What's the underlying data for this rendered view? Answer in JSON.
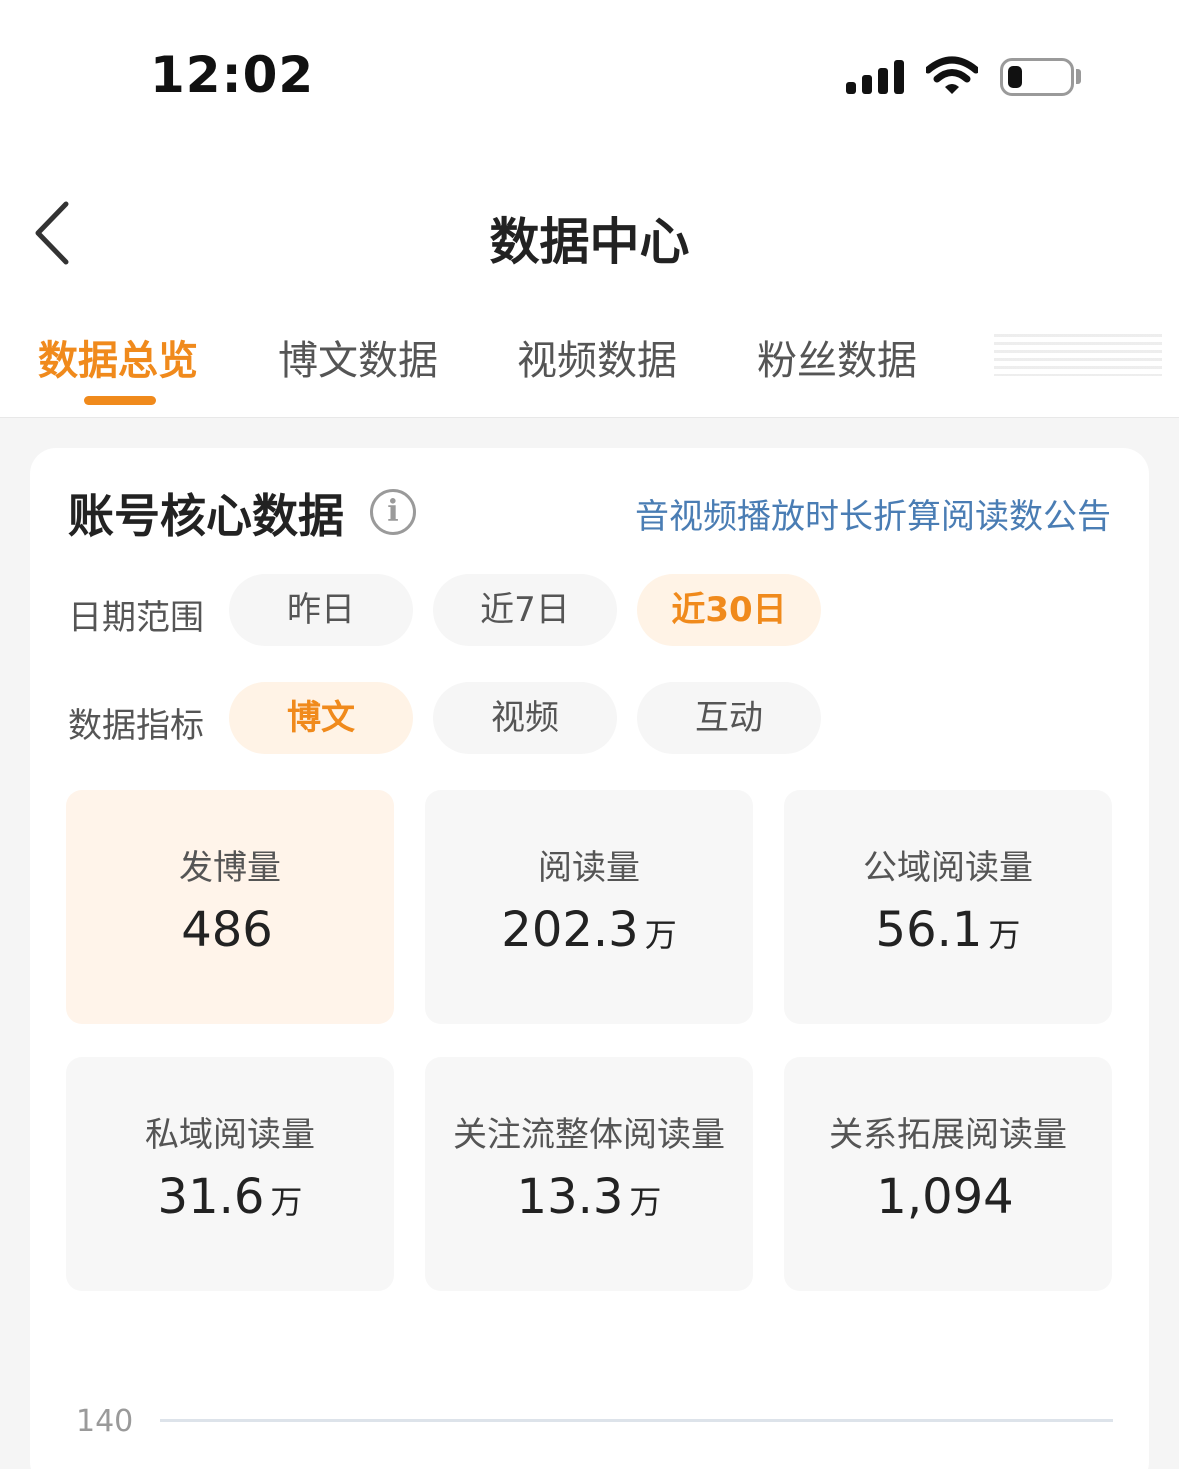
{
  "status_bar": {
    "time": "12:02"
  },
  "nav": {
    "title": "数据中心"
  },
  "tabs": [
    {
      "label": "数据总览",
      "active": true
    },
    {
      "label": "博文数据",
      "active": false
    },
    {
      "label": "视频数据",
      "active": false
    },
    {
      "label": "粉丝数据",
      "active": false
    }
  ],
  "core": {
    "title": "账号核心数据",
    "notice_link": "音视频播放时长折算阅读数公告"
  },
  "date_range": {
    "label": "日期范围",
    "options": [
      "昨日",
      "近7日",
      "近30日"
    ],
    "selected": "近30日"
  },
  "metric": {
    "label": "数据指标",
    "options": [
      "博文",
      "视频",
      "互动"
    ],
    "selected": "博文"
  },
  "stats": [
    {
      "label": "发博量",
      "value": "486",
      "unit": ""
    },
    {
      "label": "阅读量",
      "value": "202.3",
      "unit": "万"
    },
    {
      "label": "公域阅读量",
      "value": "56.1",
      "unit": "万"
    },
    {
      "label": "私域阅读量",
      "value": "31.6",
      "unit": "万"
    },
    {
      "label": "关注流整体阅读量",
      "value": "13.3",
      "unit": "万"
    },
    {
      "label": "关系拓展阅读量",
      "value": "1,094",
      "unit": ""
    }
  ],
  "chart": {
    "y_tick_top": "140"
  },
  "colors": {
    "accent": "#f08a1c",
    "link": "#4a7db4"
  }
}
